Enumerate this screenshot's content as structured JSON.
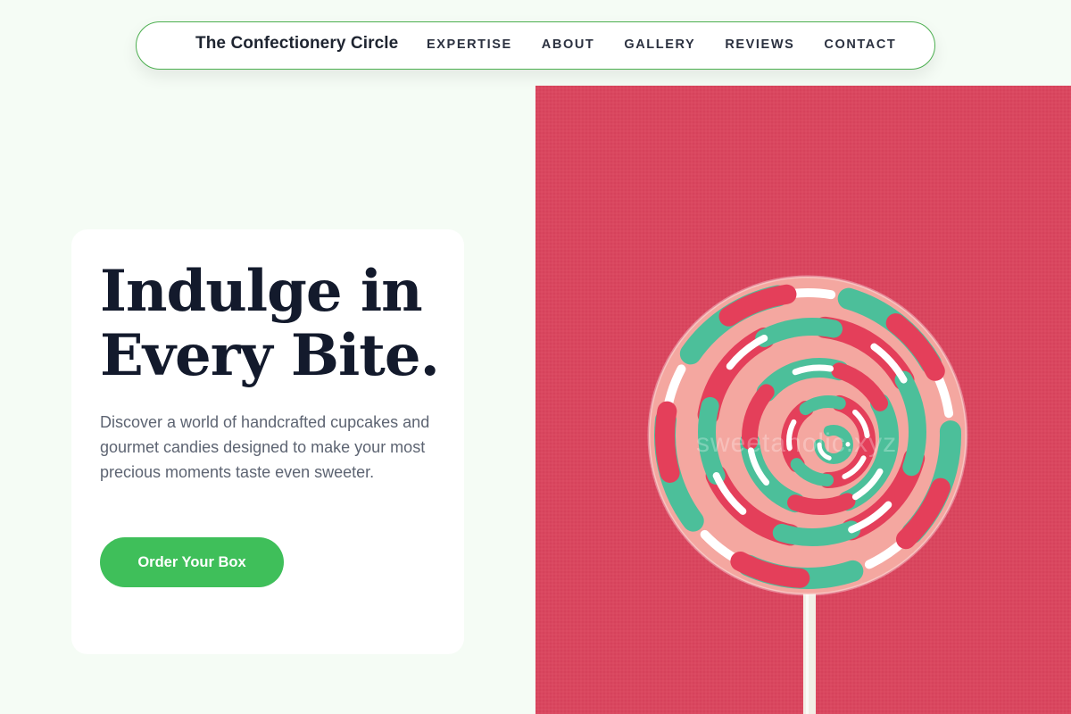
{
  "nav": {
    "brand": "The Confectionery Circle",
    "links": [
      {
        "label": "EXPERTISE"
      },
      {
        "label": "ABOUT"
      },
      {
        "label": "GALLERY"
      },
      {
        "label": "REVIEWS"
      },
      {
        "label": "CONTACT"
      }
    ]
  },
  "hero": {
    "title_line1": "Indulge in",
    "title_line2": "Every Bite.",
    "description": "Discover a world of handcrafted cupcakes and gourmet candies designed to make your most precious moments taste even sweeter.",
    "cta_label": "Order Your Box",
    "image": {
      "subject": "lollipop-photo",
      "watermark": "sweetaholic.xyz"
    }
  },
  "colors": {
    "background": "#f5fcf5",
    "accent": "#3fbf5a",
    "nav_border": "#4caf50",
    "heading": "#131a2c",
    "image_bg": "#d9475f"
  }
}
